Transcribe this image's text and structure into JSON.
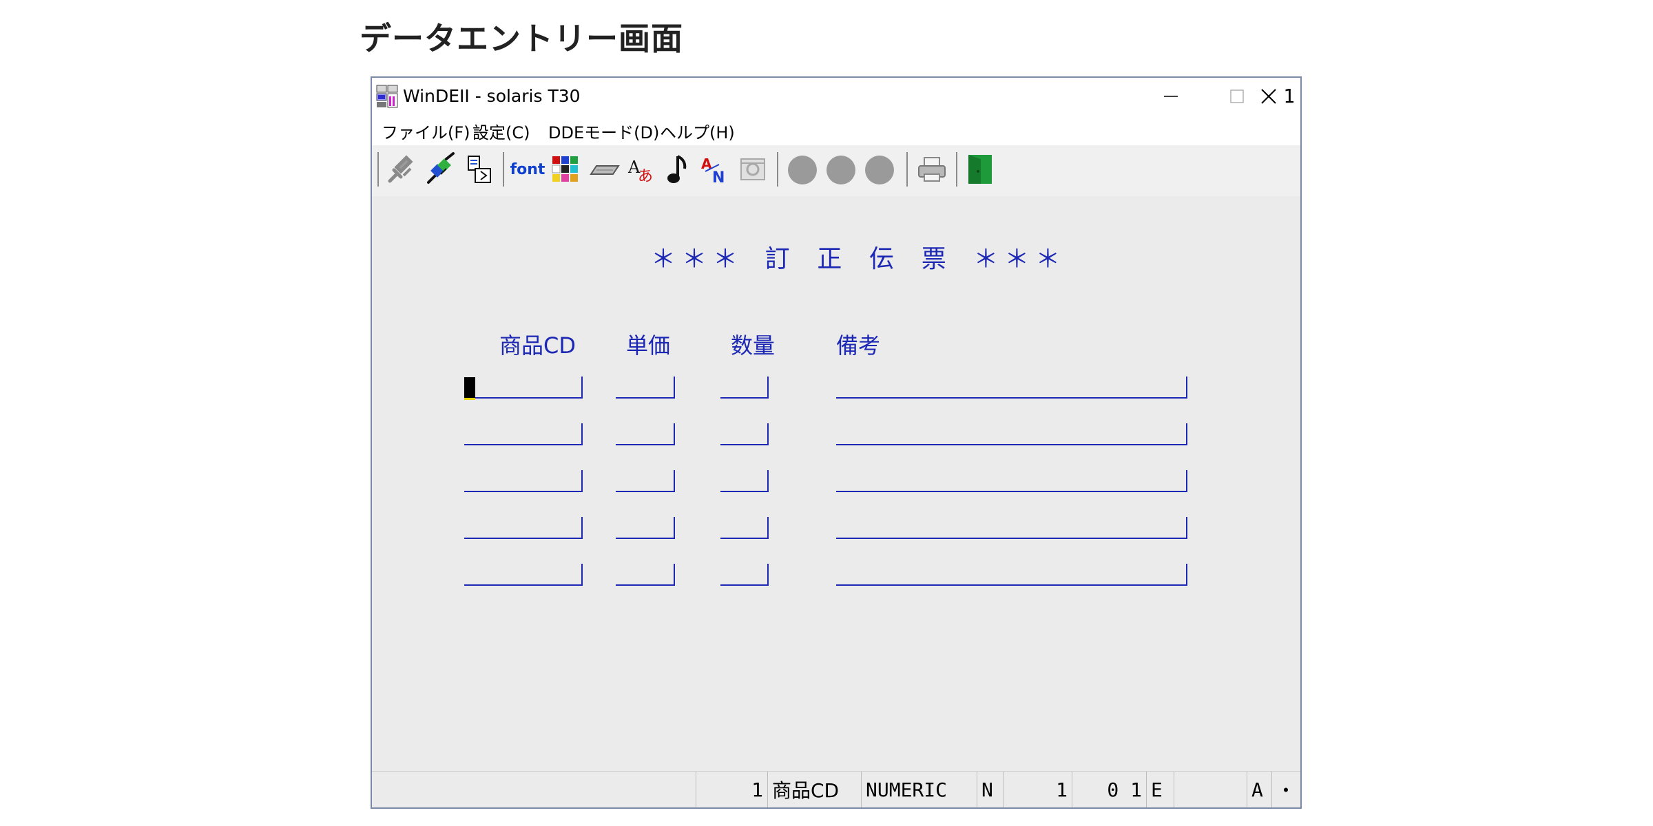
{
  "page": {
    "heading": "データエントリー画面"
  },
  "window": {
    "title": "WinDEII - solaris T30",
    "controls": {
      "minimize": "minimize-icon",
      "maximize": "maximize-icon",
      "close": "close-icon"
    }
  },
  "menu": {
    "items": [
      {
        "label": "ファイル(F)"
      },
      {
        "label": "設定(C)"
      },
      {
        "label": "DDEモード(D)"
      },
      {
        "label": "ヘルプ(H)"
      }
    ]
  },
  "toolbar": {
    "font_label": "font",
    "icons": [
      "connect-icon",
      "disconnect-icon",
      "copy-icon",
      "font-icon",
      "color-palette-icon",
      "keyboard-icon",
      "character-icon",
      "sound-icon",
      "key-mapping-icon",
      "settings-disabled-icon",
      "record-icon-1",
      "record-icon-2",
      "record-icon-3",
      "print-icon",
      "exit-icon"
    ]
  },
  "form": {
    "title": "＊＊＊ 訂 正 伝 票 ＊＊＊",
    "columns": {
      "product_cd": "商品CD",
      "unit_price": "単価",
      "quantity": "数量",
      "remarks": "備考"
    },
    "row_count": 5,
    "rows": [
      {
        "product_cd": "",
        "unit_price": "",
        "quantity": "",
        "remarks": ""
      },
      {
        "product_cd": "",
        "unit_price": "",
        "quantity": "",
        "remarks": ""
      },
      {
        "product_cd": "",
        "unit_price": "",
        "quantity": "",
        "remarks": ""
      },
      {
        "product_cd": "",
        "unit_price": "",
        "quantity": "",
        "remarks": ""
      },
      {
        "product_cd": "",
        "unit_price": "",
        "quantity": "",
        "remarks": ""
      }
    ],
    "active_field": "row 1 商品CD"
  },
  "statusbar": {
    "field_no": "1",
    "field_name": "商品CD",
    "field_type": "NUMERIC",
    "mode": "N",
    "value_1": "1",
    "value_2": "0 1",
    "flag_e": "E",
    "flag_a": "A",
    "dot": "・",
    "page": "1"
  },
  "colors": {
    "form_text": "#1c28b4",
    "client_background": "#ebebeb",
    "cursor": "#000000"
  }
}
